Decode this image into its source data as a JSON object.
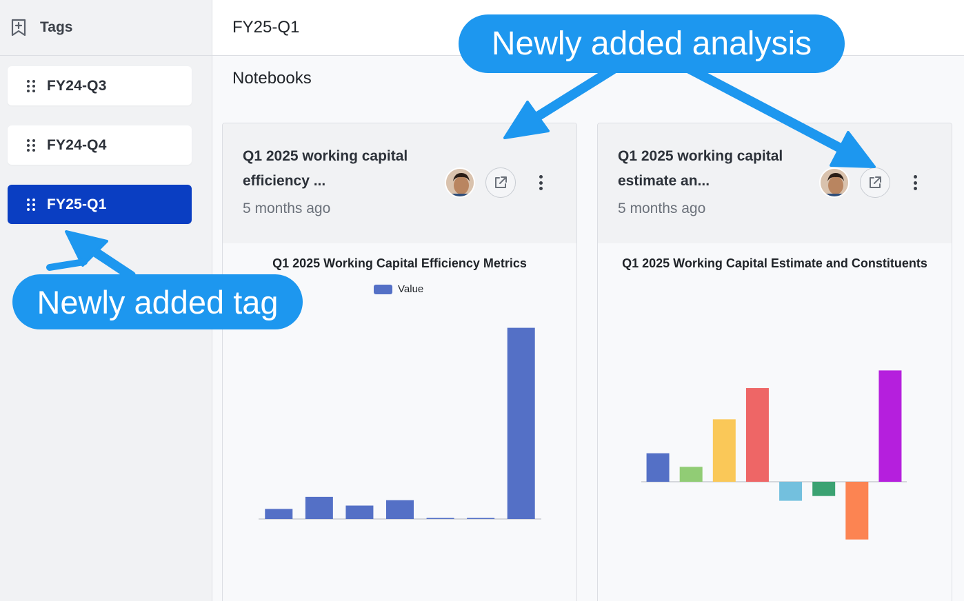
{
  "sidebar": {
    "title": "Tags",
    "tags": [
      {
        "label": "FY24-Q3",
        "active": false
      },
      {
        "label": "FY24-Q4",
        "active": false
      },
      {
        "label": "FY25-Q1",
        "active": true
      }
    ]
  },
  "header": {
    "title": "FY25-Q1"
  },
  "main": {
    "section_title": "Notebooks",
    "cards": [
      {
        "title_line1": "Q1 2025 working capital",
        "title_line2": "efficiency ...",
        "time": "5 months ago"
      },
      {
        "title_line1": "Q1 2025 working capital",
        "title_line2": "estimate an...",
        "time": "5 months ago"
      }
    ]
  },
  "annotations": {
    "analysis_callout": "Newly added analysis",
    "tag_callout": "Newly added tag"
  },
  "colors": {
    "active_tag": "#0a3ec2",
    "callout": "#1d97ef",
    "bar_primary": "#5470c6"
  },
  "chart_data": [
    {
      "type": "bar",
      "title": "Q1 2025 Working Capital Efficiency Metrics",
      "legend": [
        "Value"
      ],
      "series": [
        {
          "name": "Value",
          "color": "#5470c6",
          "values": [
            1.5,
            3.3,
            2.0,
            2.8,
            0.1,
            0.1,
            28.5
          ]
        }
      ],
      "categories": [
        "",
        "",
        "",
        "",
        "",
        "",
        ""
      ],
      "ylim": [
        0,
        30
      ],
      "grid": false
    },
    {
      "type": "bar",
      "title": "Q1 2025 Working Capital Estimate and Constituents",
      "series": [
        {
          "name": "",
          "values": [
            42,
            22,
            92,
            138,
            -28,
            -21,
            -85,
            164
          ],
          "colors": [
            "#5470c6",
            "#91cc75",
            "#fac858",
            "#ee6666",
            "#73c0de",
            "#3ba272",
            "#fc8452",
            "#b51fdd"
          ]
        }
      ],
      "categories": [
        "",
        "",
        "",
        "",
        "",
        "",
        "",
        ""
      ],
      "ylim": [
        -100,
        170
      ],
      "grid": false
    }
  ]
}
